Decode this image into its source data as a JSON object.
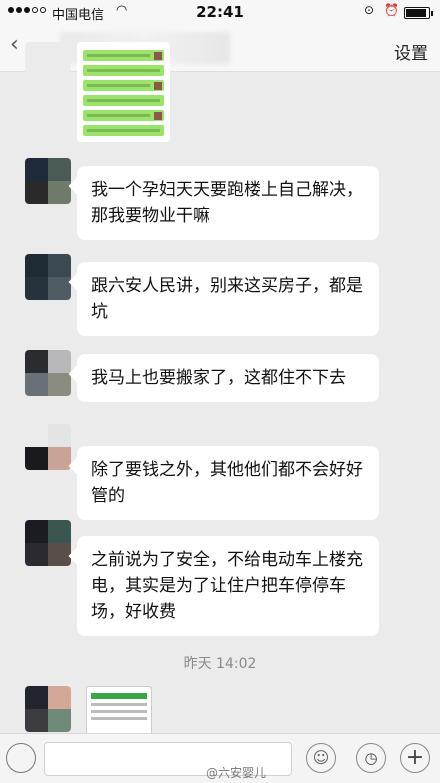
{
  "status_bar": {
    "carrier": "中国电信",
    "wifi_icon": "wifi-icon",
    "time": "22:41",
    "lock_icon": "⊙",
    "alarm_icon": "⏰"
  },
  "nav": {
    "back_icon": "‹",
    "settings_label": "设置"
  },
  "messages": [
    {
      "text": "我一个孕妇天天要跑楼上自己解决，那我要物业干嘛",
      "avatar_colors": [
        "#1f2a3a",
        "#4a5a55",
        "#2a2a2a",
        "#707a6a"
      ]
    },
    {
      "text": "跟六安人民讲，别来这买房子，都是坑",
      "avatar_colors": [
        "#1e2a34",
        "#3a4a52",
        "#26323c",
        "#505c64"
      ]
    },
    {
      "text": "我马上也要搬家了，这都住不下去",
      "avatar_colors": [
        "#2a2c30",
        "#b8b8ba",
        "#6a7078",
        "#8a8c80"
      ]
    },
    {
      "text": "除了要钱之外，其他他们都不会好好管的",
      "avatar_colors": [
        "#ebebeb",
        "#e4e4e4",
        "#1a1a1e",
        "#c9a496"
      ]
    },
    {
      "text": "之前说为了安全，不给电动车上楼充电，其实是为了让住户把车停停车场，好收费",
      "avatar_colors": [
        "#1a1c22",
        "#3a5650",
        "#2a2a30",
        "#5a4e4a"
      ]
    }
  ],
  "timestamp": "昨天 14:02",
  "last_avatar_colors": [
    "#22262c",
    "#d4a898",
    "#3a3c40",
    "#708a78"
  ],
  "input_bar": {
    "emoji_icon": "☺",
    "clock_icon": "◷",
    "plus_icon": "+"
  },
  "watermark": "@六安婴儿"
}
